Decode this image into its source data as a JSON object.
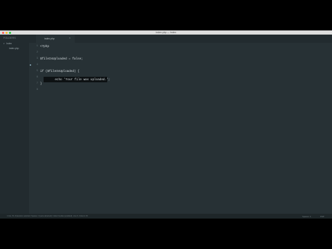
{
  "window": {
    "title": "index.php — Index"
  },
  "sidebar": {
    "header": "FOLDERS",
    "tree": [
      {
        "label": "Index",
        "expanded": true
      },
      {
        "label": "index.php",
        "expanded": false
      }
    ]
  },
  "tabs": [
    {
      "label": "index.php",
      "close": "×"
    }
  ],
  "editor": {
    "line_numbers": [
      "1",
      "2",
      "3",
      "4",
      "5",
      "6",
      "7",
      "8"
    ],
    "lines": [
      "<?php",
      "",
      "$fileIsUploaded = false;",
      "",
      "if ($fileIsUploaded) {",
      "",
      "}",
      ""
    ],
    "tooltip_line": "    echo 'Your file was uploaded.';"
  },
  "statusbar": {
    "left": "1 line, 51 characters selected; Spaces: 4 (auto-detected); Indent Guides (enabled); Line 6, Column 33",
    "spaces": "Spaces: 4",
    "syntax": "PHP"
  },
  "colors": {
    "editor_bg": "#273135",
    "sidebar_bg": "#222b2f",
    "tooltip_bg": "#0d1113"
  }
}
